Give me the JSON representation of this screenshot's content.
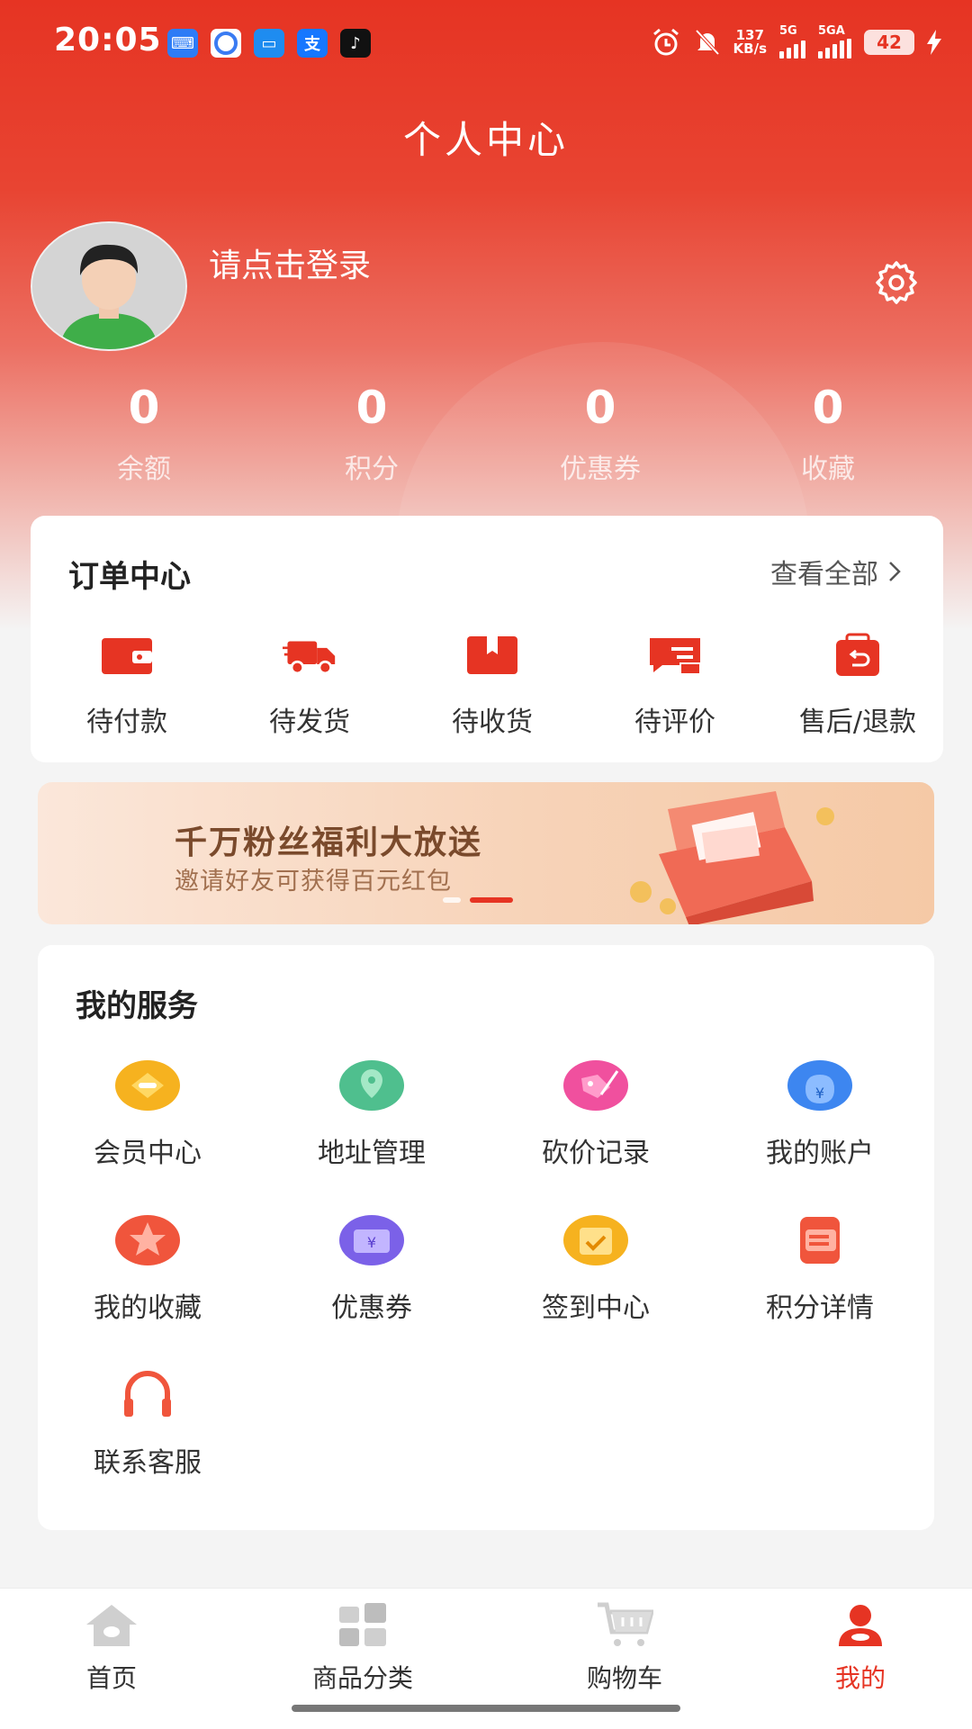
{
  "status_bar": {
    "time": "20:05",
    "net_speed_value": "137",
    "net_speed_unit": "KB/s",
    "sim1": "5G",
    "sim2": "5GA",
    "battery": "42"
  },
  "header": {
    "title": "个人中心"
  },
  "profile": {
    "login_prompt": "请点击登录"
  },
  "stats": [
    {
      "value": "0",
      "label": "余额"
    },
    {
      "value": "0",
      "label": "积分"
    },
    {
      "value": "0",
      "label": "优惠券"
    },
    {
      "value": "0",
      "label": "收藏"
    }
  ],
  "orders": {
    "title": "订单中心",
    "view_all": "查看全部",
    "items": [
      {
        "label": "待付款",
        "icon": "wallet-icon"
      },
      {
        "label": "待发货",
        "icon": "truck-icon"
      },
      {
        "label": "待收货",
        "icon": "package-icon"
      },
      {
        "label": "待评价",
        "icon": "review-icon"
      },
      {
        "label": "售后/退款",
        "icon": "refund-icon"
      }
    ]
  },
  "banner": {
    "title": "千万粉丝福利大放送",
    "subtitle": "邀请好友可获得百元红包"
  },
  "services": {
    "title": "我的服务",
    "items": [
      {
        "label": "会员中心",
        "icon": "member-icon"
      },
      {
        "label": "地址管理",
        "icon": "location-icon"
      },
      {
        "label": "砍价记录",
        "icon": "bargain-icon"
      },
      {
        "label": "我的账户",
        "icon": "account-icon"
      },
      {
        "label": "我的收藏",
        "icon": "favorite-icon"
      },
      {
        "label": "优惠券",
        "icon": "coupon-icon"
      },
      {
        "label": "签到中心",
        "icon": "checkin-icon"
      },
      {
        "label": "积分详情",
        "icon": "points-icon"
      },
      {
        "label": "联系客服",
        "icon": "headset-icon"
      }
    ]
  },
  "tabbar": {
    "items": [
      {
        "label": "首页",
        "icon": "home-icon"
      },
      {
        "label": "商品分类",
        "icon": "category-icon"
      },
      {
        "label": "购物车",
        "icon": "cart-icon"
      },
      {
        "label": "我的",
        "icon": "profile-icon"
      }
    ],
    "active_index": 3
  },
  "colors": {
    "accent": "#e63423",
    "header_gradient_top": "#e63423"
  }
}
